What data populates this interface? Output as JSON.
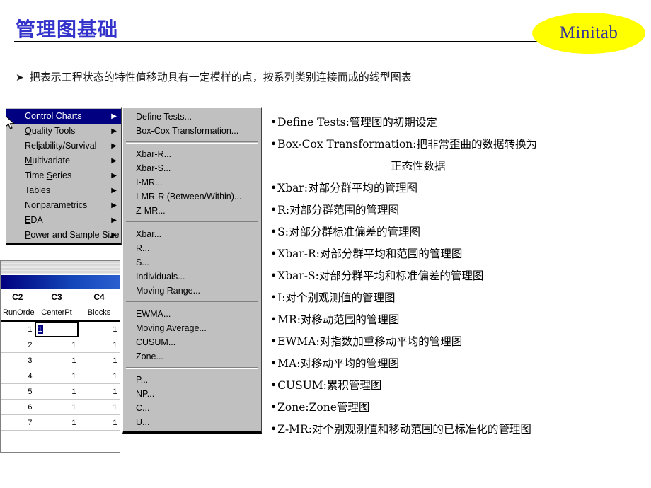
{
  "header": {
    "title": "管理图基础",
    "logo_text": "Minitab",
    "logo_bg": "#ffff00",
    "logo_fg": "#333399",
    "title_color": "#3333cc"
  },
  "lead_bullet": {
    "marker": "➤",
    "text": "把表示工程状态的特性值移动具有一定模样的点，按系列类别连接而成的线型图表"
  },
  "menu_main": {
    "items": [
      {
        "label": "Control Charts",
        "accel": "C",
        "highlighted": true,
        "submenu_arrow": "▶"
      },
      {
        "label": "Quality Tools",
        "accel": "Q",
        "highlighted": false,
        "submenu_arrow": "▶"
      },
      {
        "label": "Reliability/Survival",
        "accel": "i",
        "highlighted": false,
        "submenu_arrow": "▶"
      },
      {
        "label": "Multivariate",
        "accel": "M",
        "highlighted": false,
        "submenu_arrow": "▶"
      },
      {
        "label": "Time Series",
        "accel": "S",
        "highlighted": false,
        "submenu_arrow": "▶"
      },
      {
        "label": "Tables",
        "accel": "T",
        "highlighted": false,
        "submenu_arrow": "▶"
      },
      {
        "label": "Nonparametrics",
        "accel": "N",
        "highlighted": false,
        "submenu_arrow": "▶"
      },
      {
        "label": "EDA",
        "accel": "E",
        "highlighted": false,
        "submenu_arrow": "▶"
      },
      {
        "label": "Power and Sample Size",
        "accel": "P",
        "highlighted": false,
        "submenu_arrow": "▶"
      }
    ]
  },
  "menu_sub": {
    "groups": [
      {
        "items": [
          "Define Tests...",
          "Box-Cox Transformation..."
        ]
      },
      {
        "items": [
          "Xbar-R...",
          "Xbar-S...",
          "I-MR...",
          "I-MR-R (Between/Within)...",
          "Z-MR..."
        ]
      },
      {
        "items": [
          "Xbar...",
          "R...",
          "S...",
          "Individuals...",
          "Moving Range..."
        ]
      },
      {
        "items": [
          "EWMA...",
          "Moving Average...",
          "CUSUM...",
          "Zone..."
        ]
      },
      {
        "items": [
          "P...",
          "NP...",
          "C...",
          "U..."
        ]
      }
    ]
  },
  "worksheet": {
    "column_ids": [
      "C2",
      "C3",
      "C4"
    ],
    "column_names": [
      "RunOrder",
      "CenterPt",
      "Blocks"
    ],
    "rows": [
      {
        "num": "1",
        "cells": [
          "1",
          "1",
          "1"
        ],
        "selected_col": 1
      },
      {
        "num": "2",
        "cells": [
          "2",
          "1",
          "1"
        ],
        "selected_col": -1
      },
      {
        "num": "3",
        "cells": [
          "3",
          "1",
          "1"
        ],
        "selected_col": -1
      },
      {
        "num": "4",
        "cells": [
          "4",
          "1",
          "1"
        ],
        "selected_col": -1
      },
      {
        "num": "5",
        "cells": [
          "5",
          "1",
          "1"
        ],
        "selected_col": -1
      },
      {
        "num": "6",
        "cells": [
          "6",
          "1",
          "1"
        ],
        "selected_col": -1
      },
      {
        "num": "7",
        "cells": [
          "7",
          "1",
          "1"
        ],
        "selected_col": -1
      }
    ]
  },
  "descriptions": [
    {
      "bullet": "•",
      "text": "Define Tests:管理图的初期设定",
      "indent": false
    },
    {
      "bullet": "•",
      "text": "Box-Cox Transformation:把非常歪曲的数据转换为",
      "indent": false
    },
    {
      "bullet": "",
      "text": "正态性数据",
      "indent": true
    },
    {
      "bullet": "•",
      "text": "Xbar:对部分群平均的管理图",
      "indent": false
    },
    {
      "bullet": "•",
      "text": "R:对部分群范围的管理图",
      "indent": false
    },
    {
      "bullet": "•",
      "text": "S:对部分群标准偏差的管理图",
      "indent": false
    },
    {
      "bullet": "•",
      "text": "Xbar-R:对部分群平均和范围的管理图",
      "indent": false
    },
    {
      "bullet": "•",
      "text": "Xbar-S:对部分群平均和标准偏差的管理图",
      "indent": false
    },
    {
      "bullet": "•",
      "text": "I:对个别观测值的管理图",
      "indent": false
    },
    {
      "bullet": "•",
      "text": "MR:对移动范围的管理图",
      "indent": false
    },
    {
      "bullet": "•",
      "text": "EWMA:对指数加重移动平均的管理图",
      "indent": false
    },
    {
      "bullet": "•",
      "text": "MA:对移动平均的管理图",
      "indent": false
    },
    {
      "bullet": "•",
      "text": "CUSUM:累积管理图",
      "indent": false
    },
    {
      "bullet": "•",
      "text": "Zone:Zone管理图",
      "indent": false
    },
    {
      "bullet": "•",
      "text": "Z-MR:对个别观测值和移动范围的已标准化的管理图",
      "indent": false
    }
  ]
}
